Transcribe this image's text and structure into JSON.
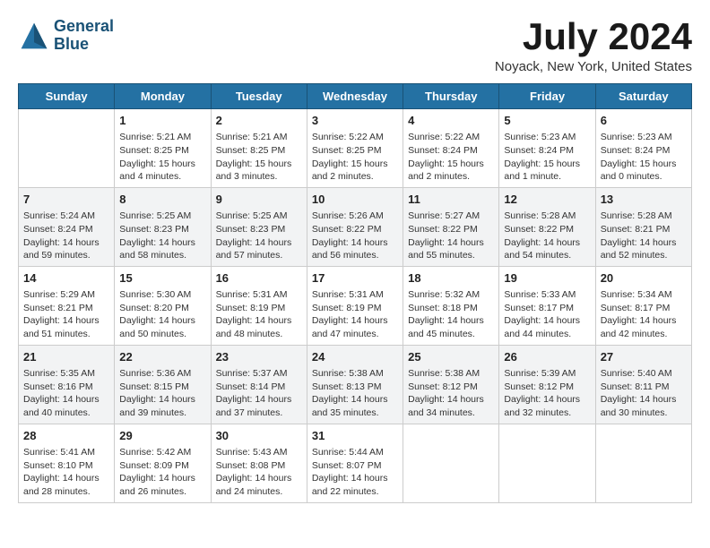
{
  "header": {
    "logo_line1": "General",
    "logo_line2": "Blue",
    "month_title": "July 2024",
    "location": "Noyack, New York, United States"
  },
  "days_of_week": [
    "Sunday",
    "Monday",
    "Tuesday",
    "Wednesday",
    "Thursday",
    "Friday",
    "Saturday"
  ],
  "weeks": [
    [
      {
        "date": "",
        "empty": true
      },
      {
        "date": "1",
        "sunrise": "Sunrise: 5:21 AM",
        "sunset": "Sunset: 8:25 PM",
        "daylight": "Daylight: 15 hours and 4 minutes."
      },
      {
        "date": "2",
        "sunrise": "Sunrise: 5:21 AM",
        "sunset": "Sunset: 8:25 PM",
        "daylight": "Daylight: 15 hours and 3 minutes."
      },
      {
        "date": "3",
        "sunrise": "Sunrise: 5:22 AM",
        "sunset": "Sunset: 8:25 PM",
        "daylight": "Daylight: 15 hours and 2 minutes."
      },
      {
        "date": "4",
        "sunrise": "Sunrise: 5:22 AM",
        "sunset": "Sunset: 8:24 PM",
        "daylight": "Daylight: 15 hours and 2 minutes."
      },
      {
        "date": "5",
        "sunrise": "Sunrise: 5:23 AM",
        "sunset": "Sunset: 8:24 PM",
        "daylight": "Daylight: 15 hours and 1 minute."
      },
      {
        "date": "6",
        "sunrise": "Sunrise: 5:23 AM",
        "sunset": "Sunset: 8:24 PM",
        "daylight": "Daylight: 15 hours and 0 minutes."
      }
    ],
    [
      {
        "date": "7",
        "sunrise": "Sunrise: 5:24 AM",
        "sunset": "Sunset: 8:24 PM",
        "daylight": "Daylight: 14 hours and 59 minutes."
      },
      {
        "date": "8",
        "sunrise": "Sunrise: 5:25 AM",
        "sunset": "Sunset: 8:23 PM",
        "daylight": "Daylight: 14 hours and 58 minutes."
      },
      {
        "date": "9",
        "sunrise": "Sunrise: 5:25 AM",
        "sunset": "Sunset: 8:23 PM",
        "daylight": "Daylight: 14 hours and 57 minutes."
      },
      {
        "date": "10",
        "sunrise": "Sunrise: 5:26 AM",
        "sunset": "Sunset: 8:22 PM",
        "daylight": "Daylight: 14 hours and 56 minutes."
      },
      {
        "date": "11",
        "sunrise": "Sunrise: 5:27 AM",
        "sunset": "Sunset: 8:22 PM",
        "daylight": "Daylight: 14 hours and 55 minutes."
      },
      {
        "date": "12",
        "sunrise": "Sunrise: 5:28 AM",
        "sunset": "Sunset: 8:22 PM",
        "daylight": "Daylight: 14 hours and 54 minutes."
      },
      {
        "date": "13",
        "sunrise": "Sunrise: 5:28 AM",
        "sunset": "Sunset: 8:21 PM",
        "daylight": "Daylight: 14 hours and 52 minutes."
      }
    ],
    [
      {
        "date": "14",
        "sunrise": "Sunrise: 5:29 AM",
        "sunset": "Sunset: 8:21 PM",
        "daylight": "Daylight: 14 hours and 51 minutes."
      },
      {
        "date": "15",
        "sunrise": "Sunrise: 5:30 AM",
        "sunset": "Sunset: 8:20 PM",
        "daylight": "Daylight: 14 hours and 50 minutes."
      },
      {
        "date": "16",
        "sunrise": "Sunrise: 5:31 AM",
        "sunset": "Sunset: 8:19 PM",
        "daylight": "Daylight: 14 hours and 48 minutes."
      },
      {
        "date": "17",
        "sunrise": "Sunrise: 5:31 AM",
        "sunset": "Sunset: 8:19 PM",
        "daylight": "Daylight: 14 hours and 47 minutes."
      },
      {
        "date": "18",
        "sunrise": "Sunrise: 5:32 AM",
        "sunset": "Sunset: 8:18 PM",
        "daylight": "Daylight: 14 hours and 45 minutes."
      },
      {
        "date": "19",
        "sunrise": "Sunrise: 5:33 AM",
        "sunset": "Sunset: 8:17 PM",
        "daylight": "Daylight: 14 hours and 44 minutes."
      },
      {
        "date": "20",
        "sunrise": "Sunrise: 5:34 AM",
        "sunset": "Sunset: 8:17 PM",
        "daylight": "Daylight: 14 hours and 42 minutes."
      }
    ],
    [
      {
        "date": "21",
        "sunrise": "Sunrise: 5:35 AM",
        "sunset": "Sunset: 8:16 PM",
        "daylight": "Daylight: 14 hours and 40 minutes."
      },
      {
        "date": "22",
        "sunrise": "Sunrise: 5:36 AM",
        "sunset": "Sunset: 8:15 PM",
        "daylight": "Daylight: 14 hours and 39 minutes."
      },
      {
        "date": "23",
        "sunrise": "Sunrise: 5:37 AM",
        "sunset": "Sunset: 8:14 PM",
        "daylight": "Daylight: 14 hours and 37 minutes."
      },
      {
        "date": "24",
        "sunrise": "Sunrise: 5:38 AM",
        "sunset": "Sunset: 8:13 PM",
        "daylight": "Daylight: 14 hours and 35 minutes."
      },
      {
        "date": "25",
        "sunrise": "Sunrise: 5:38 AM",
        "sunset": "Sunset: 8:12 PM",
        "daylight": "Daylight: 14 hours and 34 minutes."
      },
      {
        "date": "26",
        "sunrise": "Sunrise: 5:39 AM",
        "sunset": "Sunset: 8:12 PM",
        "daylight": "Daylight: 14 hours and 32 minutes."
      },
      {
        "date": "27",
        "sunrise": "Sunrise: 5:40 AM",
        "sunset": "Sunset: 8:11 PM",
        "daylight": "Daylight: 14 hours and 30 minutes."
      }
    ],
    [
      {
        "date": "28",
        "sunrise": "Sunrise: 5:41 AM",
        "sunset": "Sunset: 8:10 PM",
        "daylight": "Daylight: 14 hours and 28 minutes."
      },
      {
        "date": "29",
        "sunrise": "Sunrise: 5:42 AM",
        "sunset": "Sunset: 8:09 PM",
        "daylight": "Daylight: 14 hours and 26 minutes."
      },
      {
        "date": "30",
        "sunrise": "Sunrise: 5:43 AM",
        "sunset": "Sunset: 8:08 PM",
        "daylight": "Daylight: 14 hours and 24 minutes."
      },
      {
        "date": "31",
        "sunrise": "Sunrise: 5:44 AM",
        "sunset": "Sunset: 8:07 PM",
        "daylight": "Daylight: 14 hours and 22 minutes."
      },
      {
        "date": "",
        "empty": true
      },
      {
        "date": "",
        "empty": true
      },
      {
        "date": "",
        "empty": true
      }
    ]
  ]
}
